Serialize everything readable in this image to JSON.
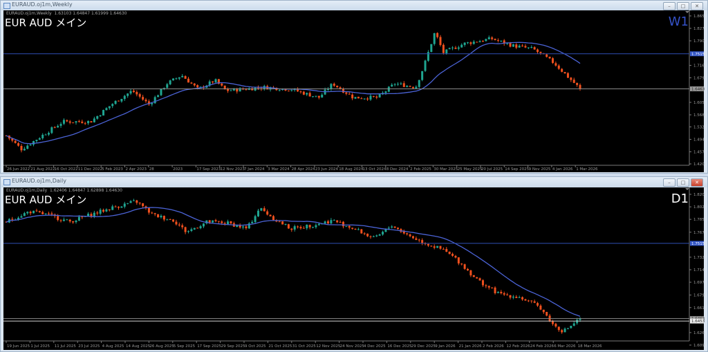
{
  "colors": {
    "bull": "#1fa591",
    "bear": "#f0501e",
    "ma": "#4b63d6",
    "hline_blue": "#2f4fb5",
    "hline_gray": "#8c8c8c",
    "axis": "#7a7a7a",
    "w1_label": "#3552c8",
    "d1_label": "#ffffff"
  },
  "windows": [
    {
      "title": "EURAUD.oj1m,Weekly",
      "header": "EURAUD.oj1m,Weekly  1.63103 1.64847 1.61999 1.64630",
      "symbol_label": "EUR AUD メイン",
      "timeframe": "W1",
      "buttons": {
        "minimize": "–",
        "maximize": "□",
        "close": "✕"
      },
      "price_ticks": [
        "1.86530",
        "1.82790",
        "1.79050",
        "1.71680",
        "1.67940",
        "1.60570",
        "1.56830",
        "1.53200",
        "1.49460",
        "1.45720",
        "1.42090"
      ],
      "price_levels": [
        {
          "label": "1.75158",
          "kind": "blue"
        },
        {
          "label": "1.64630",
          "kind": "gray"
        }
      ],
      "date_ticks": [
        "26 Jun 2022",
        "21 Aug 2022",
        "16 Oct 2022",
        "11 Dec 2022",
        "5 Feb 2023",
        "2 Apr 2023",
        "28",
        "2023",
        "17 Sep 2023",
        "12 Nov 2023",
        "7 Jan 2024",
        "3 Mar 2024",
        "28 Apr 2024",
        "23 Jun 2024",
        "18 Aug 2024",
        "13 Oct 2024",
        "8 Dec 2024",
        "2 Feb 2025",
        "30 Mar 2025",
        "25 May 2025",
        "20 Jul 2025",
        "14 Sep 2025",
        "9 Nov 2025",
        "4 Jan 2026",
        "1 Mar 2026"
      ]
    },
    {
      "title": "EURAUD.oj1m,Daily",
      "header": "EURAUD.oj1m,Daily  1.62406 1.64847 1.62898 1.64630",
      "symbol_label": "EUR AUD メイン",
      "timeframe": "D1",
      "buttons": {
        "minimize": "–",
        "maximize": "□",
        "close": "✕"
      },
      "price_ticks": [
        "1.82020",
        "1.80270",
        "1.78520",
        "1.76720",
        "1.73220",
        "1.71470",
        "1.69720",
        "1.67920",
        "1.66170",
        "1.62670",
        "1.60920"
      ],
      "price_levels": [
        {
          "label": "1.75158",
          "kind": "blue"
        },
        {
          "label": "1.64630",
          "kind": "gray"
        },
        {
          "label": "1.64531",
          "kind": "white"
        }
      ],
      "date_ticks": [
        "19 Jun 2025",
        "1 Jul 2025",
        "11 Jul 2025",
        "23 Jul 2025",
        "4 Aug 2025",
        "14 Aug 2025",
        "26 Aug 2025",
        "5 Sep 2025",
        "17 Sep 2025",
        "29 Sep 2025",
        "9 Oct 2025",
        "21 Oct 2025",
        "31 Oct 2025",
        "12 Nov 2025",
        "24 Nov 2025",
        "4 Dec 2025",
        "16 Dec 2025",
        "29 Dec 2025",
        "9 Jan 2026",
        "21 Jan 2026",
        "2 Feb 2026",
        "12 Feb 2026",
        "24 Feb 2026",
        "6 Mar 2026",
        "18 Mar 2026"
      ]
    }
  ],
  "chart_data": [
    {
      "type": "candlestick",
      "title": "EUR AUD メイン",
      "timeframe": "W1",
      "ylim": [
        1.4209,
        1.8653
      ],
      "grid": false,
      "indicator": "moving average (blue)",
      "approx_close": [
        [
          "2022-06-26",
          1.506
        ],
        [
          "2022-08-01",
          1.465
        ],
        [
          "2022-09-18",
          1.506
        ],
        [
          "2022-11-06",
          1.548
        ],
        [
          "2023-01-10",
          1.548
        ],
        [
          "2023-02-27",
          1.599
        ],
        [
          "2023-04-17",
          1.641
        ],
        [
          "2023-05-27",
          1.599
        ],
        [
          "2023-07-07",
          1.662
        ],
        [
          "2023-08-11",
          1.687
        ],
        [
          "2023-09-18",
          1.645
        ],
        [
          "2023-10-28",
          1.672
        ],
        [
          "2023-11-22",
          1.641
        ],
        [
          "2024-01-01",
          1.645
        ],
        [
          "2024-02-19",
          1.651
        ],
        [
          "2024-04-23",
          1.645
        ],
        [
          "2024-06-27",
          1.62
        ],
        [
          "2024-07-30",
          1.662
        ],
        [
          "2024-09-16",
          1.62
        ],
        [
          "2024-11-12",
          1.62
        ],
        [
          "2024-12-22",
          1.662
        ],
        [
          "2025-02-09",
          1.651
        ],
        [
          "2025-02-28",
          1.714
        ],
        [
          "2025-03-26",
          1.817
        ],
        [
          "2025-04-15",
          1.755
        ],
        [
          "2025-06-02",
          1.782
        ],
        [
          "2025-08-06",
          1.797
        ],
        [
          "2025-09-24",
          1.776
        ],
        [
          "2025-11-11",
          1.766
        ],
        [
          "2025-12-30",
          1.724
        ],
        [
          "2026-01-31",
          1.683
        ],
        [
          "2026-03-01",
          1.6463
        ]
      ]
    },
    {
      "type": "candlestick",
      "title": "EUR AUD メイン",
      "timeframe": "D1",
      "ylim": [
        1.6092,
        1.8202
      ],
      "grid": false,
      "indicator": "moving average (blue)",
      "approx_close": [
        [
          "2025-06-19",
          1.7818
        ],
        [
          "2025-06-30",
          1.7962
        ],
        [
          "2025-07-09",
          1.7914
        ],
        [
          "2025-07-19",
          1.7818
        ],
        [
          "2025-07-29",
          1.7914
        ],
        [
          "2025-08-08",
          1.801
        ],
        [
          "2025-08-20",
          1.8106
        ],
        [
          "2025-08-28",
          1.7914
        ],
        [
          "2025-09-07",
          1.7838
        ],
        [
          "2025-09-13",
          1.7675
        ],
        [
          "2025-09-23",
          1.7818
        ],
        [
          "2025-10-03",
          1.7799
        ],
        [
          "2025-10-12",
          1.7722
        ],
        [
          "2025-10-18",
          1.801
        ],
        [
          "2025-10-26",
          1.7838
        ],
        [
          "2025-11-02",
          1.7722
        ],
        [
          "2025-11-12",
          1.777
        ],
        [
          "2025-11-22",
          1.7838
        ],
        [
          "2025-12-02",
          1.7722
        ],
        [
          "2025-12-12",
          1.7579
        ],
        [
          "2025-12-20",
          1.777
        ],
        [
          "2025-12-28",
          1.7627
        ],
        [
          "2026-01-04",
          1.7531
        ],
        [
          "2026-01-14",
          1.7416
        ],
        [
          "2026-01-20",
          1.7291
        ],
        [
          "2026-01-30",
          1.7003
        ],
        [
          "2026-02-09",
          1.6811
        ],
        [
          "2026-02-19",
          1.6763
        ],
        [
          "2026-03-01",
          1.662
        ],
        [
          "2026-03-07",
          1.638
        ],
        [
          "2026-03-12",
          1.6284
        ],
        [
          "2026-03-20",
          1.6463
        ]
      ]
    }
  ]
}
